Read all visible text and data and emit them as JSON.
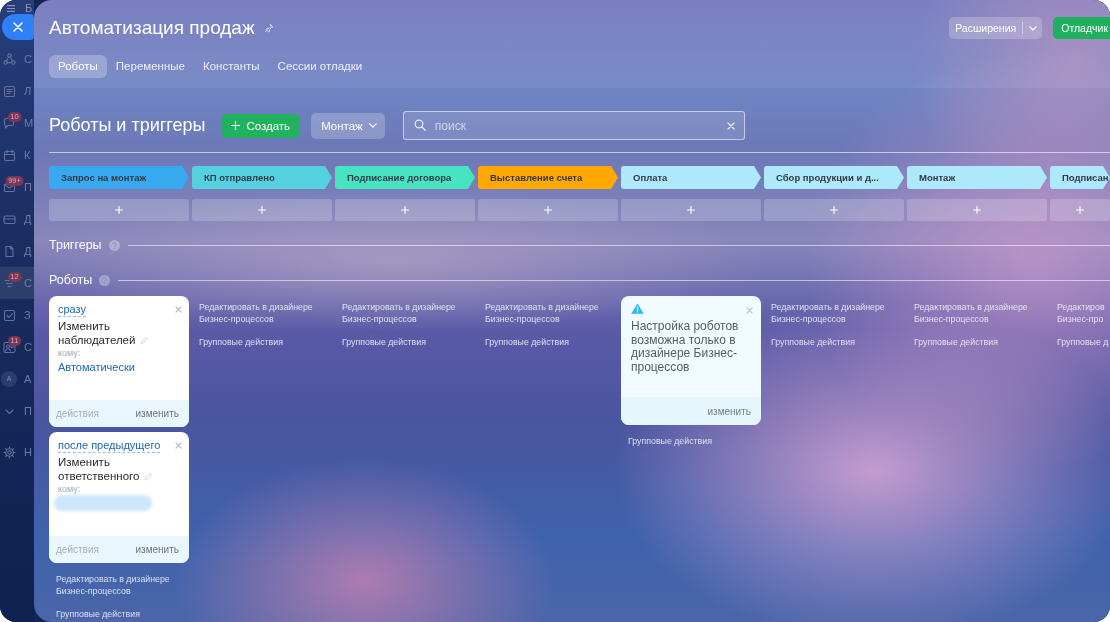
{
  "sidebar": {
    "logo": "Б",
    "items": [
      {
        "kind": "team",
        "letter": "С",
        "selected": false
      },
      {
        "kind": "news",
        "letter": "Л",
        "selected": false
      },
      {
        "kind": "chat",
        "letter": "М",
        "badge": "10",
        "selected": false
      },
      {
        "kind": "calendar",
        "letter": "К",
        "selected": false
      },
      {
        "kind": "mail",
        "letter": "П",
        "badge": "99+",
        "selected": false
      },
      {
        "kind": "card",
        "letter": "Д",
        "selected": false
      },
      {
        "kind": "document",
        "letter": "Д",
        "selected": false
      },
      {
        "kind": "filter",
        "letter": "С",
        "badge": "12",
        "selected": true
      },
      {
        "kind": "task",
        "letter": "З",
        "selected": false
      },
      {
        "kind": "group",
        "letter": "С",
        "badge": "11",
        "selected": false
      },
      {
        "kind": "avatar",
        "initial": "A",
        "letter": "А",
        "selected": false
      },
      {
        "kind": "more",
        "letter": "П",
        "selected": false
      },
      {
        "kind": "settings",
        "letter": "Н",
        "selected": false
      }
    ]
  },
  "header": {
    "title": "Автоматизация продаж",
    "buttons": [
      {
        "kind": "split",
        "label": "Расширения"
      },
      {
        "kind": "primary",
        "label": "Отладчик"
      }
    ]
  },
  "tabs": [
    {
      "label": "Роботы",
      "selected": true
    },
    {
      "label": "Переменные",
      "selected": false
    },
    {
      "label": "Константы",
      "selected": false
    },
    {
      "label": "Сессии отладки",
      "selected": false
    }
  ],
  "toolbar": {
    "title": "Роботы и триггеры",
    "create_button": "Создать",
    "stage_filter": "Монтаж",
    "search": {
      "placeholder": "поиск"
    }
  },
  "stages": [
    {
      "label": "Запрос на монтаж",
      "color": "#39a9ef"
    },
    {
      "label": "КП отправлено",
      "color": "#55d0e0"
    },
    {
      "label": "Подписание договора",
      "color": "#47e4c2"
    },
    {
      "label": "Выставление счета",
      "color": "#ffa900"
    },
    {
      "label": "Оплата",
      "color": "#aee8fb"
    },
    {
      "label": "Сбор продукции и д...",
      "color": "#aee8fb"
    },
    {
      "label": "Монтаж",
      "color": "#aee8fb"
    },
    {
      "label": "Подписан",
      "color": "#aee8fb"
    }
  ],
  "sections": [
    {
      "title": "Триггеры"
    },
    {
      "title": "Роботы"
    }
  ],
  "robot_columns": [
    {
      "robots": [
        {
          "kind": "robot",
          "delay": "сразу",
          "title": "Изменить наблюдателей",
          "to_label": "кому:",
          "value": "Автоматически",
          "value_hidden": false,
          "actions": {
            "label": "действия",
            "disabled": true
          },
          "edit": "изменить"
        },
        {
          "kind": "robot",
          "delay": "после предыдущего",
          "title": "Изменить ответственного",
          "to_label": "кому:",
          "value_hidden": true,
          "actions": {
            "label": "действия",
            "disabled": true
          },
          "edit": "изменить"
        }
      ],
      "edit_link": "Редактировать в дизайнере Бизнес-процессов",
      "group_link": "Групповые действия"
    },
    {
      "edit_link": "Редактировать в дизайнере Бизнес-процессов",
      "group_link": "Групповые действия"
    },
    {
      "edit_link": "Редактировать в дизайнере Бизнес-процессов",
      "group_link": "Групповые действия"
    },
    {
      "edit_link": "Редактировать в дизайнере Бизнес-процессов",
      "group_link": "Групповые действия"
    },
    {
      "robots": [
        {
          "kind": "notice",
          "text": "Настройка роботов возможна только в дизайнере Бизнес-процессов",
          "edit": "изменить"
        }
      ],
      "group_link": "Групповые действия"
    },
    {
      "edit_link": "Редактировать в дизайнере Бизнес-процессов",
      "group_link": "Групповые действия"
    },
    {
      "edit_link": "Редактировать в дизайнере Бизнес-процессов",
      "group_link": "Групповые действия"
    },
    {
      "edit_link": "Редактиров Бизнес-про",
      "group_link": "Групповые д"
    }
  ]
}
